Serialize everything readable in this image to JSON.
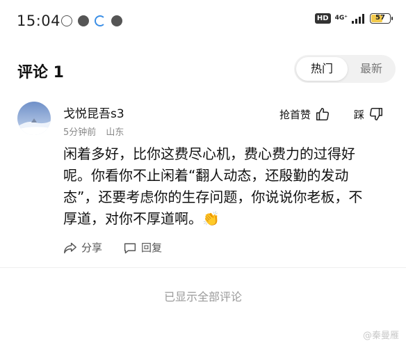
{
  "status_bar": {
    "time": "15:04",
    "hd": "HD",
    "network": "4G⁺",
    "battery": "57"
  },
  "header": {
    "title": "评论 1",
    "tabs": [
      {
        "label": "热门",
        "active": true
      },
      {
        "label": "最新",
        "active": false
      }
    ]
  },
  "comment": {
    "username": "戈悦昆吾s3",
    "time_ago": "5分钟前",
    "location": "山东",
    "first_like_label": "抢首赞",
    "dislike_label": "踩",
    "body": "闲着多好，比你这费尽心机，费心费力的过得好呢。你看你不止闲着“翻人动态，还殷勤的发动态”，还要考虑你的生存问题，你说说你老板，不厚道，对你不厚道啊。👏",
    "share_label": "分享",
    "reply_label": "回复"
  },
  "footer": {
    "all_shown": "已显示全部评论"
  },
  "watermark": "@秦曼雁"
}
